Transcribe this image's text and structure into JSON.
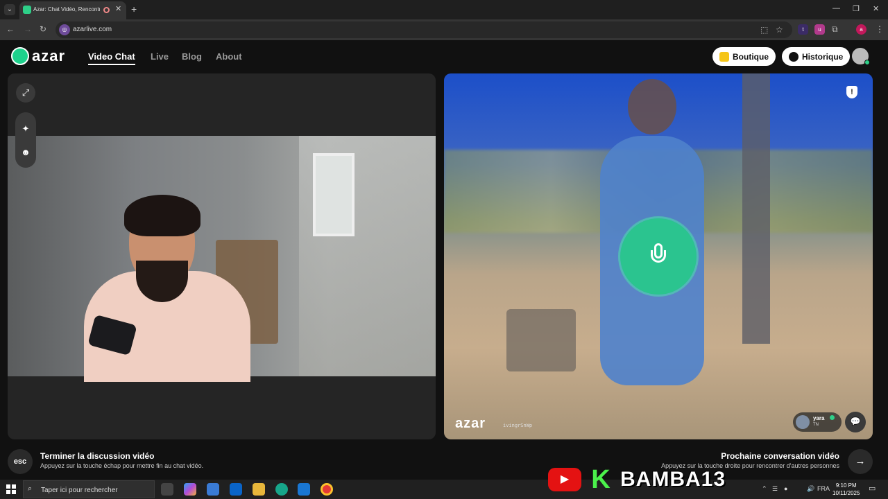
{
  "browser": {
    "tab_title": "Azar: Chat Vidéo, Rencontre",
    "tab_close": "✕",
    "new_tab": "+",
    "url": "azarlive.com",
    "controls": {
      "minimize": "—",
      "maximize": "❐",
      "close": "✕"
    },
    "extensions": [
      "t",
      "u",
      "a"
    ]
  },
  "site": {
    "logo_text": "azar",
    "nav": [
      {
        "label": "Video Chat",
        "active": true
      },
      {
        "label": "Live",
        "active": false
      },
      {
        "label": "Blog",
        "active": false
      },
      {
        "label": "About",
        "active": false
      }
    ],
    "shop_label": "Boutique",
    "history_label": "Historique"
  },
  "call": {
    "peer_watermark": "azar",
    "peer_id": "ivingrSnWp",
    "peer_name": "yara",
    "peer_country": "TN",
    "mic_state": "muted-request"
  },
  "bottom": {
    "esc_label": "esc",
    "end_title": "Terminer la discussion vidéo",
    "end_desc": "Appuyez sur la touche échap pour mettre fin au chat vidéo.",
    "next_title": "Prochaine conversation vidéo",
    "next_desc": "Appuyez sur la touche droite pour rencontrer d'autres personnes",
    "next_icon": "→"
  },
  "watermark": {
    "brand": "BAMBA13",
    "k_letter": "K",
    "yt_icon": "▶"
  },
  "taskbar": {
    "search_placeholder": "Taper ici pour rechercher",
    "language": "FRA",
    "time": "9:10 PM",
    "date": "10/11/2025"
  },
  "colors": {
    "accent_green": "#2ecf88",
    "mic_green": "#2bc48f",
    "boutique_icon": "#f5c518"
  }
}
